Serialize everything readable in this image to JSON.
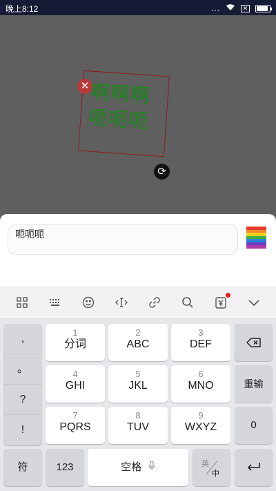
{
  "status_bar": {
    "time": "晚上8:12",
    "dots": "...",
    "sim": "✕"
  },
  "canvas": {
    "sticker_lines": [
      "啊啊啊",
      "呃呃呃"
    ],
    "colors": {
      "frame": "#8b1e1e",
      "text": "#178a17",
      "delete": "#b83a3a"
    }
  },
  "panel": {
    "input_value": "呃呃呃",
    "rainbow_colors": [
      "#e83b2e",
      "#f28a2a",
      "#f5d020",
      "#3cb043",
      "#2f7fd8",
      "#6a3fc2",
      "#b03aa8"
    ]
  },
  "toolbar": {
    "icons": [
      "grid-icon",
      "keyboard-icon",
      "emoji-icon",
      "cursor-move-icon",
      "link-icon",
      "search-icon",
      "wallet-icon",
      "collapse-icon"
    ]
  },
  "keyboard": {
    "punct": [
      ",",
      "。",
      "?",
      "!"
    ],
    "rows": [
      [
        {
          "num": "1",
          "let": "分词"
        },
        {
          "num": "2",
          "let": "ABC"
        },
        {
          "num": "3",
          "let": "DEF"
        }
      ],
      [
        {
          "num": "4",
          "let": "GHI"
        },
        {
          "num": "5",
          "let": "JKL"
        },
        {
          "num": "6",
          "let": "MNO"
        }
      ],
      [
        {
          "num": "7",
          "let": "PQRS"
        },
        {
          "num": "8",
          "let": "TUV"
        },
        {
          "num": "9",
          "let": "WXYZ"
        }
      ]
    ],
    "reenter": "重输",
    "zero": "0",
    "symbols": "符",
    "numbers": "123",
    "space": "空格",
    "lang_en": "英",
    "lang_zh": "中"
  }
}
